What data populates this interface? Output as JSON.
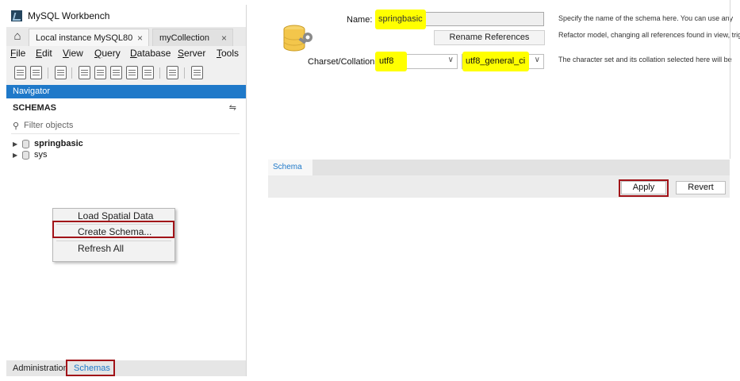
{
  "window": {
    "title": "MySQL Workbench",
    "tabs": [
      {
        "label": "Local instance MySQL80",
        "close": "×"
      },
      {
        "label": "myCollection",
        "close": "×"
      }
    ]
  },
  "menu": [
    "File",
    "Edit",
    "View",
    "Query",
    "Database",
    "Server",
    "Tools"
  ],
  "navigator": {
    "header": "Navigator",
    "section_title": "SCHEMAS",
    "filter_placeholder": "Filter objects",
    "schemas": [
      {
        "name": "springbasic",
        "bold": true
      },
      {
        "name": "sys",
        "bold": false
      }
    ],
    "bottom_tabs": [
      "Administration",
      "Schemas"
    ]
  },
  "context_menu": {
    "items": [
      "Load Spatial Data",
      "Create Schema...",
      "Refresh All"
    ]
  },
  "schema_editor": {
    "name_label": "Name:",
    "name_value": "springbasic",
    "rename_button": "Rename References",
    "charset_label": "Charset/Collation:",
    "charset_value": "utf8",
    "collation_value": "utf8_general_ci",
    "help_name_1": "Specify the name of the schema here. You can use any",
    "help_name_2": "Refactor model, changing all references found in view, trigg",
    "help_charset": "The character set and its collation selected here will be",
    "tab_label": "Schema",
    "apply_button": "Apply",
    "revert_button": "Revert"
  },
  "colors": {
    "highlight": "#ffff00",
    "annotation_red": "#a11218",
    "navigator_blue": "#1f79c9"
  }
}
